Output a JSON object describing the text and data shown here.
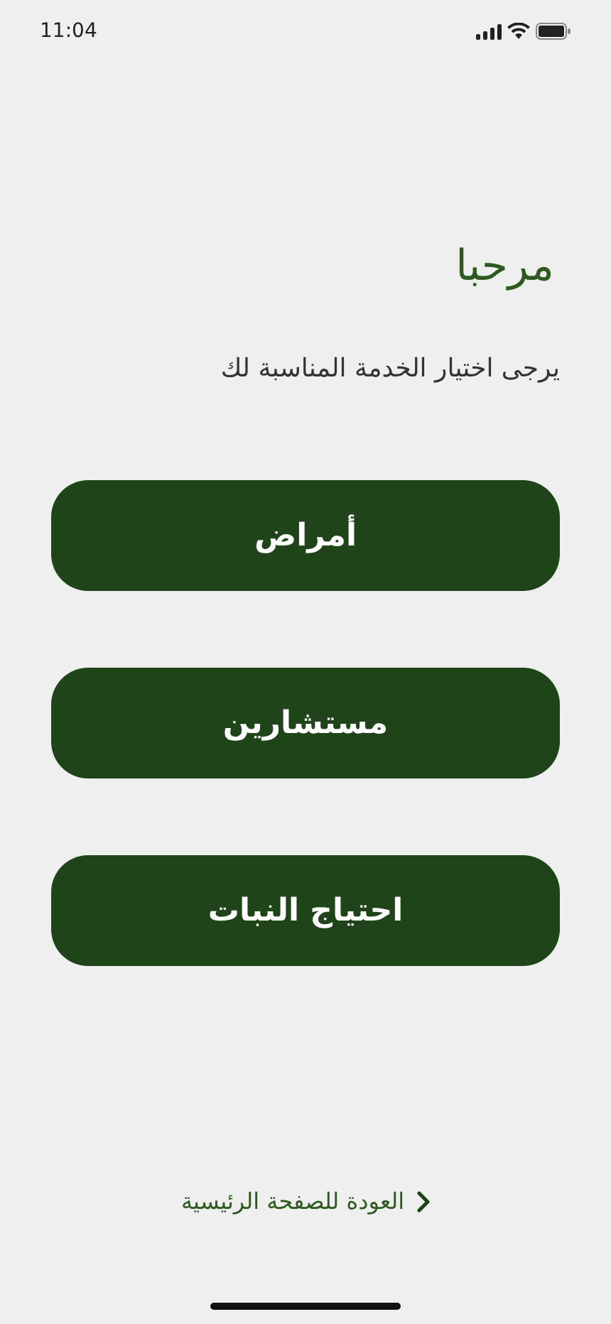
{
  "status_bar": {
    "time": "11:04"
  },
  "title": "مرحبا",
  "subtitle": "يرجى اختيار الخدمة المناسبة لك",
  "buttons": [
    {
      "label": "أمراض"
    },
    {
      "label": "مستشارين"
    },
    {
      "label": "احتياج النبات"
    }
  ],
  "back_link": {
    "label": "العودة للصفحة الرئيسية"
  }
}
